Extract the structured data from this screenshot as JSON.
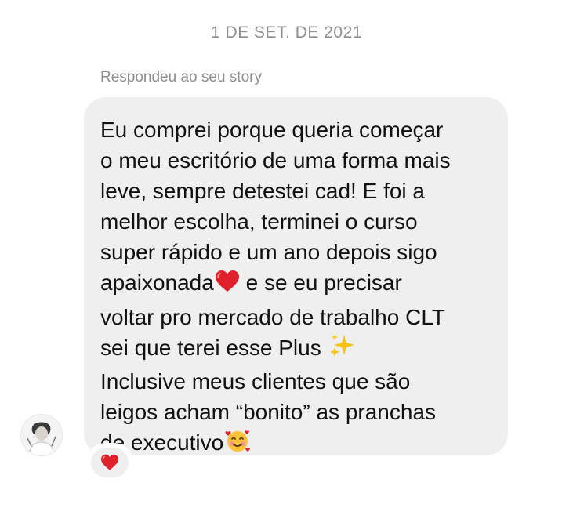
{
  "thread": {
    "date_separator": "1 DE SET. DE 2021",
    "story_reply_label": "Respondeu ao seu story"
  },
  "message": {
    "lines": [
      "Eu comprei porque queria começar",
      "o meu escritório de uma forma mais",
      "leve, sempre detestei cad! E foi a",
      "melhor escolha, terminei o curso",
      "super rápido e um ano depois sigo",
      "apaixonada",
      " e se eu precisar",
      "voltar pro mercado de trabalho CLT",
      "sei que terei esse Plus ",
      "Inclusive meus clientes que são",
      "leigos acham “bonito” as pranchas",
      "de executivo"
    ],
    "inline_emoji": [
      "red-heart-icon",
      "sparkles-icon",
      "smiling-face-with-hearts-icon"
    ],
    "bubble_color": "#efefef"
  },
  "sender": {
    "avatar_icon": "user-avatar-icon"
  },
  "reaction": {
    "icon": "red-heart-icon",
    "color": "#e0202b"
  }
}
